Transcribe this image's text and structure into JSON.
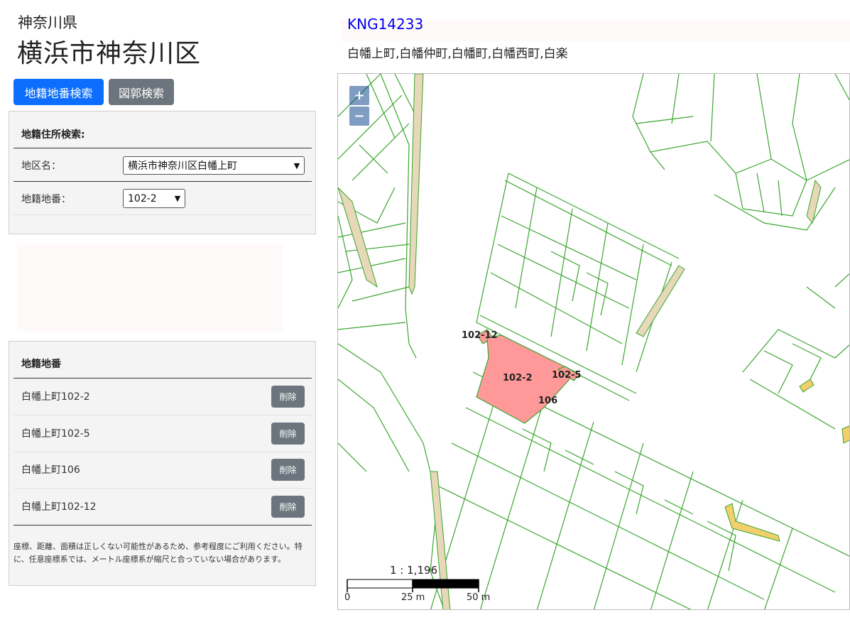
{
  "header": {
    "prefecture": "神奈川県",
    "city": "横浜市神奈川区"
  },
  "buttons": {
    "chiban_search": "地籍地番検索",
    "zukaku_search": "図郭検索"
  },
  "search_panel": {
    "title": "地籍住所検索:",
    "district_label": "地区名：",
    "district_value": "横浜市神奈川区白幡上町",
    "lot_label": "地籍地番：",
    "lot_value": "102-2"
  },
  "lot_list": {
    "title": "地籍地番",
    "items": [
      {
        "label": "白幡上町102-2",
        "action": "削除"
      },
      {
        "label": "白幡上町102-5",
        "action": "削除"
      },
      {
        "label": "白幡上町106",
        "action": "削除"
      },
      {
        "label": "白幡上町102-12",
        "action": "削除"
      }
    ],
    "disclaimer": "座標、距離、面積は正しくない可能性があるため、参考程度にご利用ください。特に、任意座標系では、メートル座標系が縮尺と合っていない場合があります。"
  },
  "map_header": {
    "code": "KNG14233",
    "towns": "白幡上町,白幡仲町,白幡町,白幡西町,白楽"
  },
  "map": {
    "zoom_in": "+",
    "zoom_out": "−",
    "scale_ratio": "1 : 1,196",
    "scale_labels": [
      "0",
      "25 m",
      "50 m"
    ],
    "parcel_labels": [
      "102-12",
      "102-2",
      "102-5",
      "106"
    ],
    "colors": {
      "parcel_line": "#3aa52e",
      "selected_fill": "#ff9999",
      "road_fill": "#e6d8b8",
      "highlight_fill": "#f2cf6a"
    }
  }
}
